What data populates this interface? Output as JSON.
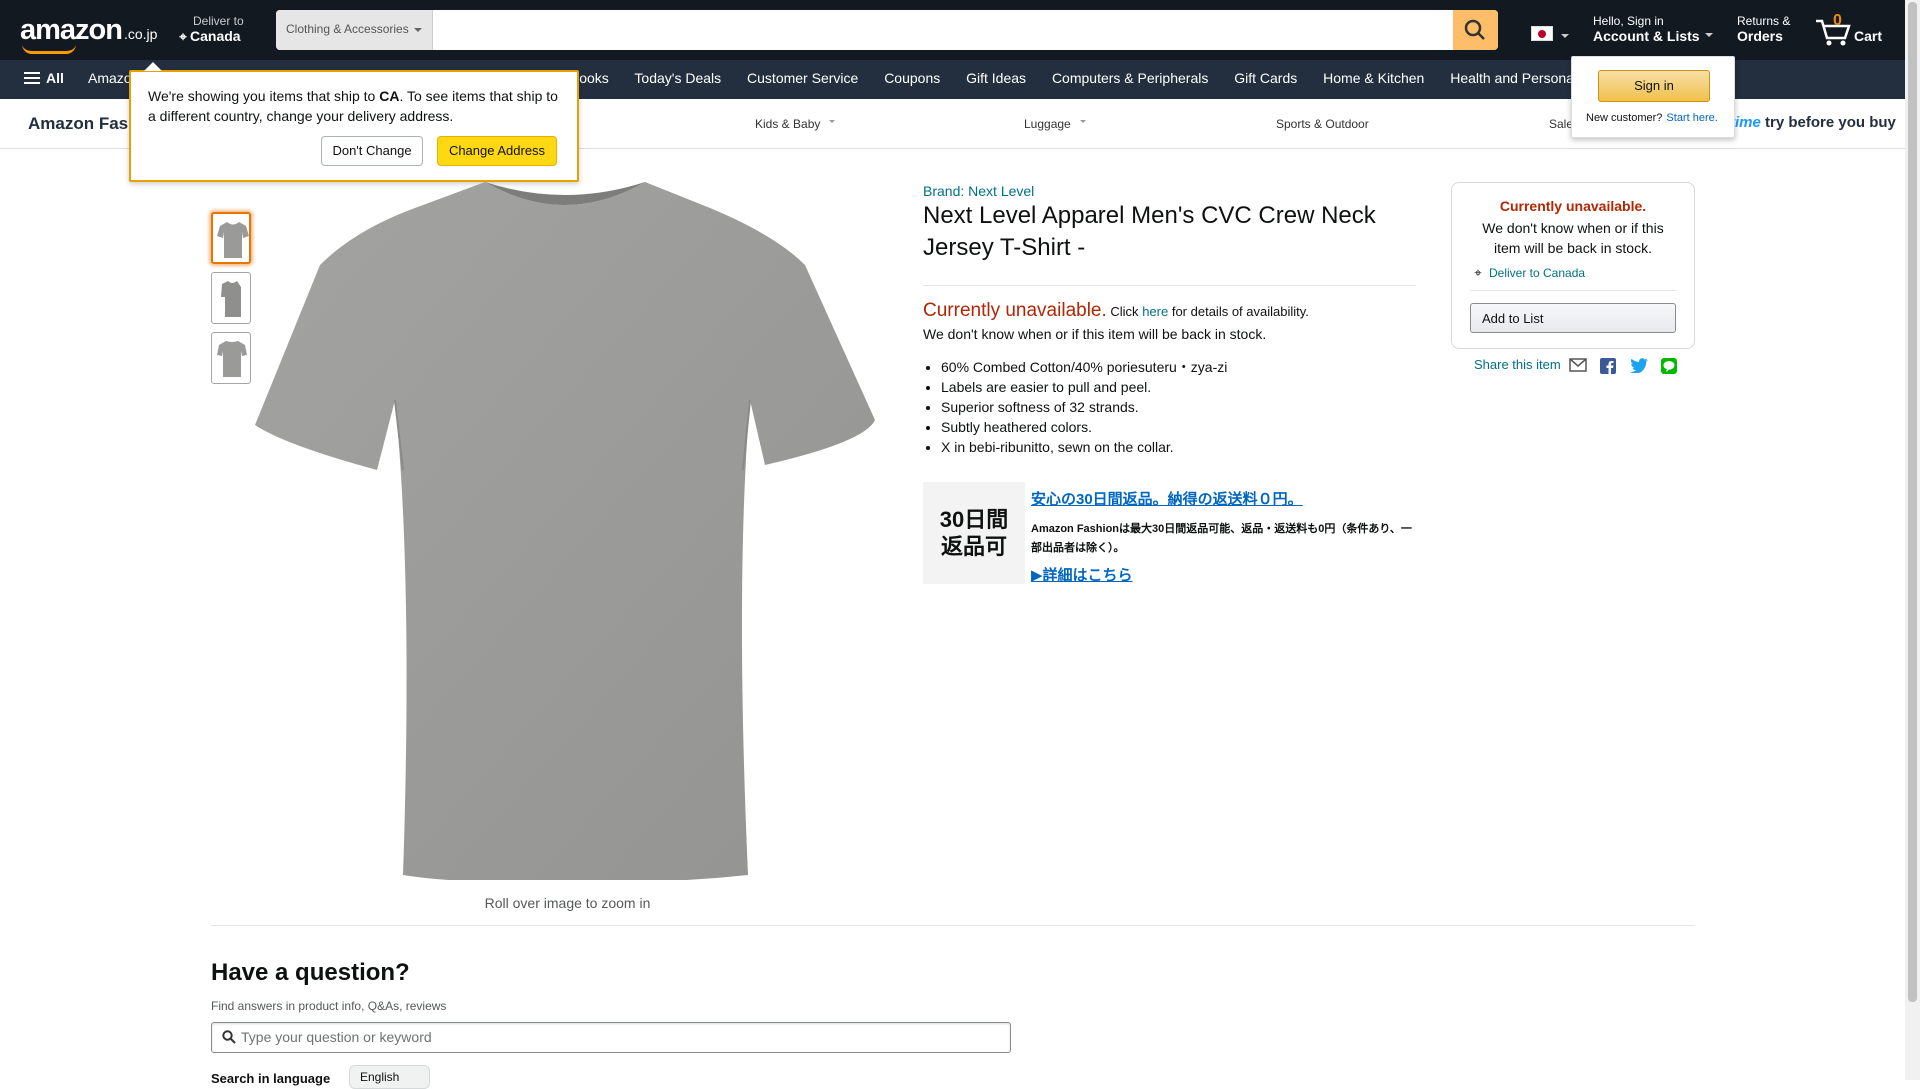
{
  "header": {
    "logo_text": "amazon",
    "logo_tld": ".co.jp",
    "deliver_line1": "Deliver to",
    "deliver_line2": "Canada",
    "search_category": "Clothing & Accessories",
    "search_placeholder": "",
    "account_line1": "Hello, Sign in",
    "account_line2": "Account & Lists",
    "returns_line1": "Returns &",
    "returns_line2": "Orders",
    "cart_count": "0",
    "cart_label": "Cart"
  },
  "nav": {
    "all_label": "All",
    "links": [
      "Amazon",
      "",
      "",
      "Japanese Books",
      "Today's Deals",
      "Customer Service",
      "Coupons",
      "Gift Ideas",
      "Computers & Peripherals",
      "Gift Cards",
      "Home & Kitchen",
      "Health and Personal Care"
    ]
  },
  "fashion_nav": {
    "title": "Amazon Fashion",
    "items": [
      "Kids & Baby",
      "Luggage",
      "Sports & Outdoor",
      "Sale"
    ],
    "prime_label": "prime",
    "try_label": "try before you buy"
  },
  "location_popover": {
    "message_pre": "We're showing you items that ship to ",
    "message_country": "CA",
    "message_post": ". To see items that ship to a different country, change your delivery address.",
    "dont_change": "Don't Change",
    "change_address": "Change Address"
  },
  "signin_popover": {
    "button": "Sign in",
    "new_customer": "New customer?",
    "start_here": "Start here."
  },
  "product": {
    "brand": "Brand: Next Level",
    "title": "Next Level Apparel Men's CVC Crew Neck Jersey T-Shirt -",
    "unavailable": "Currently unavailable.",
    "click": "Click",
    "here": "here",
    "details": "for details of availability.",
    "unavailable_msg": "We don't know when or if this item will be back in stock.",
    "bullets": [
      "60% Combed Cotton/40% poriesuteru・zya-zi",
      "Labels are easier to pull and peel.",
      "Superior softness of 32 strands.",
      "Subtly heathered colors.",
      "X in bebi-ribunitto, sewn on the collar."
    ],
    "zoom_hint": "Roll over image to zoom in",
    "image_color": "#9a9a98"
  },
  "returns_promo": {
    "badge_line1": "30日間",
    "badge_line2": "返品可",
    "headline": "安心の30日間返品。納得の返送料０円。",
    "body": "Amazon Fashionは最大30日間返品可能、返品・返送料も0円（条件あり、一部出品者は除く）。",
    "link": "▶詳細はこちら"
  },
  "buybox": {
    "unavailable": "Currently unavailable.",
    "message": "We don't know when or if this item will be back in stock.",
    "deliver": "Deliver to Canada",
    "add_to_list": "Add to List",
    "share": "Share this item"
  },
  "qa": {
    "title": "Have a question?",
    "subtitle": "Find answers in product info, Q&As, reviews",
    "placeholder": "Type your question or keyword",
    "lang_label": "Search in language",
    "lang_value": "English"
  },
  "colors": {
    "header_bg": "#131921",
    "nav_bg": "#232f3e",
    "accent_orange": "#ff9900",
    "price_red": "#b12704",
    "link_teal": "#007185"
  }
}
